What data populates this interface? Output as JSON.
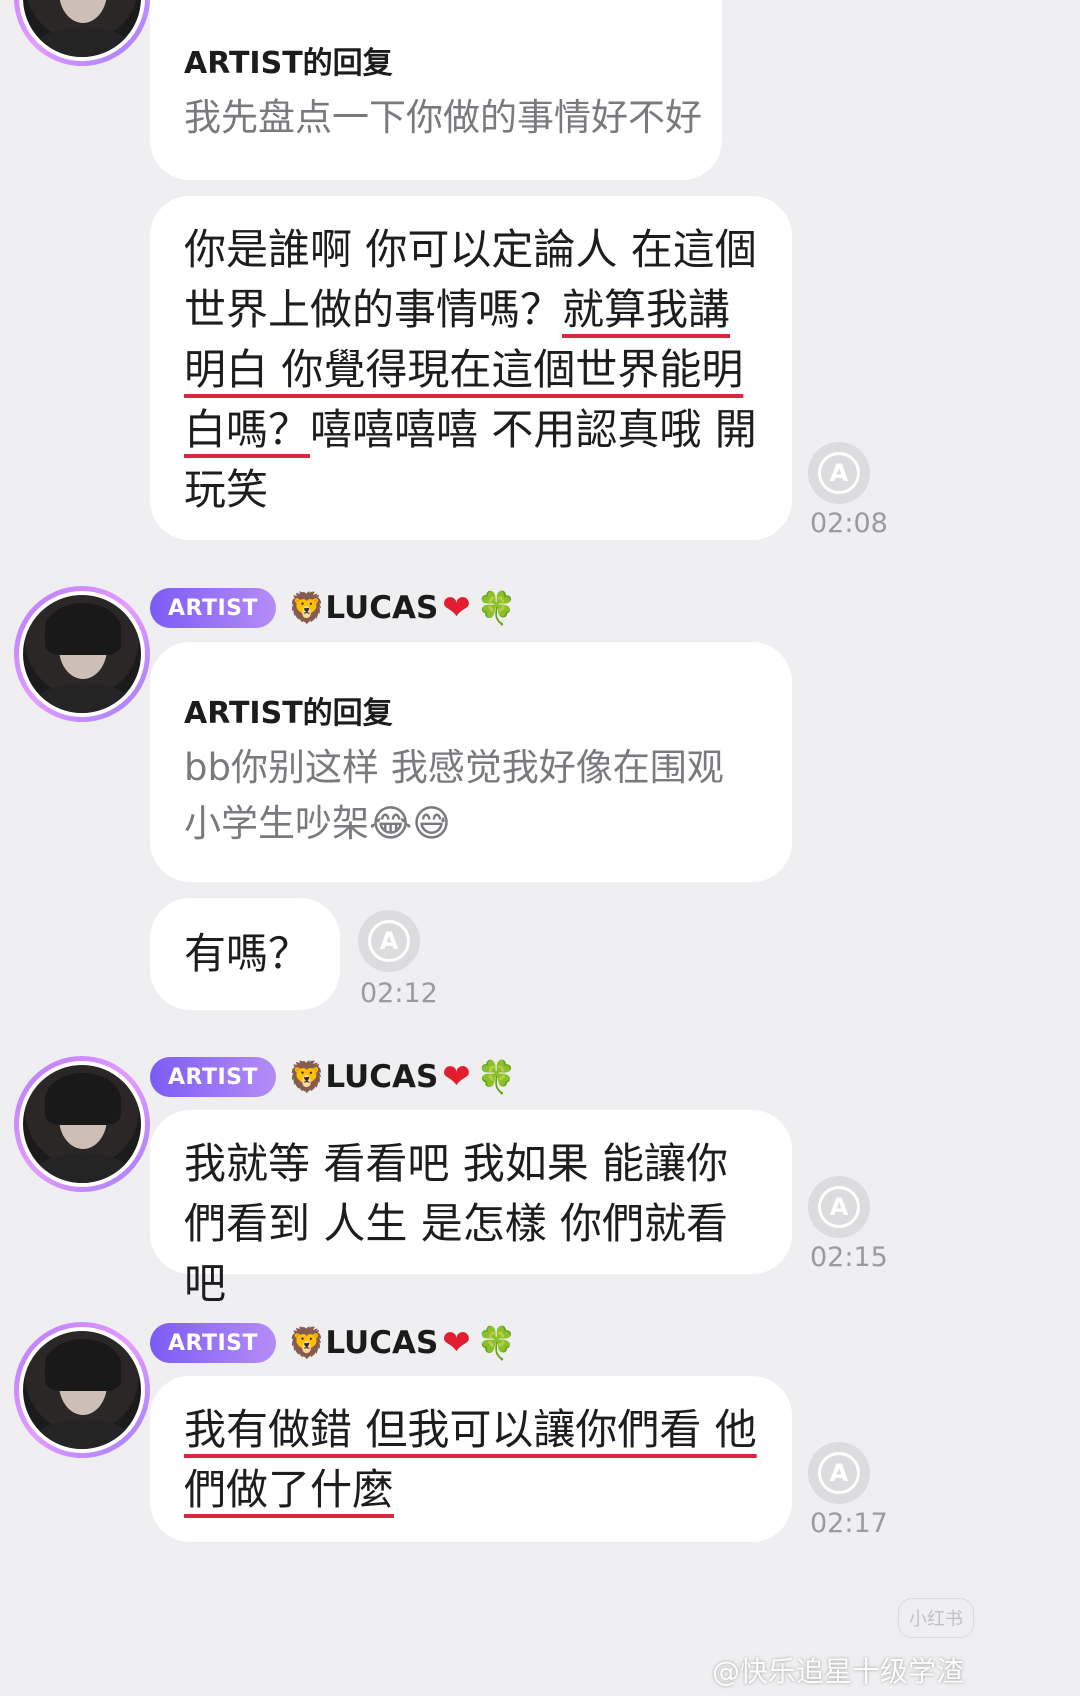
{
  "chat": {
    "block1": {
      "reply_title": "ARTIST的回复",
      "reply_text": "我先盘点一下你做的事情好不好",
      "msg_part1": "你是誰啊 你可以定論人 在這個世界上做的事情嗎？",
      "msg_underlined": "就算我講明白 你覺得現在這個世界能明白嗎？",
      "msg_part2": "嘻嘻嘻嘻 不用認真哦 開玩笑",
      "time": "02:08"
    },
    "block2": {
      "badge": "ARTIST",
      "username": "LUCAS",
      "reply_title": "ARTIST的回复",
      "reply_text": "bb你别这样 我感觉我好像在围观小学生吵架😂😅",
      "msg": "有嗎？",
      "time": "02:12"
    },
    "block3": {
      "badge": "ARTIST",
      "username": "LUCAS",
      "msg": "我就等 看看吧 我如果 能讓你們看到 人生 是怎樣 你們就看吧",
      "time": "02:15"
    },
    "block4": {
      "badge": "ARTIST",
      "username": "LUCAS",
      "msg_underlined": "我有做錯 但我可以讓你們看 他們做了什麼",
      "time": "02:17"
    }
  },
  "icons": {
    "translate": "A",
    "lion": "🦁",
    "heart": "❤",
    "clover": "🍀"
  },
  "watermark": {
    "text": "@快乐追星十级学渣",
    "small": "小红书"
  },
  "colors": {
    "background": "#efeff1",
    "badge_start": "#7b5cf5",
    "badge_end": "#b58cf8",
    "underline": "#d6283f"
  }
}
